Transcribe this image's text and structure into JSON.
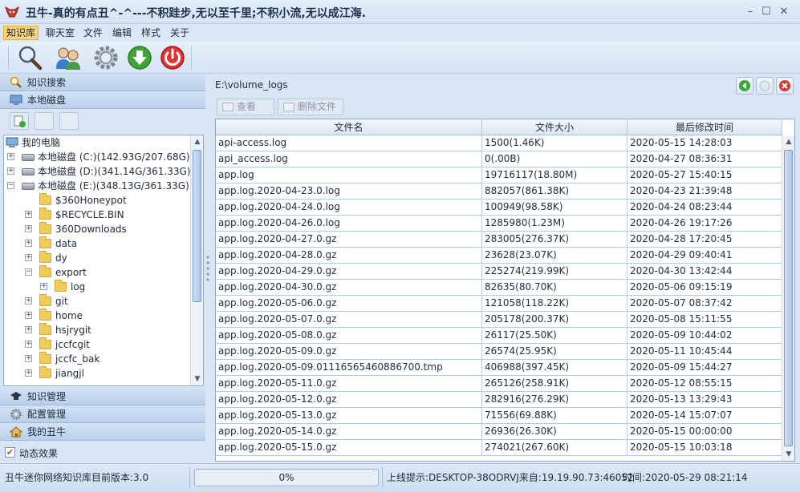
{
  "window": {
    "title": "丑牛-真的有点丑^-^---不积跬步,无以至千里;不积小流,无以成江海.",
    "minimize": "–",
    "maximize": "☐",
    "close": "✕"
  },
  "menu": [
    "知识库",
    "聊天室",
    "文件",
    "编辑",
    "样式",
    "关于"
  ],
  "sidebar": {
    "search": "知识搜索",
    "local_disk": "本地磁盘",
    "knowledge_mgmt": "知识管理",
    "config_mgmt": "配置管理",
    "my_chouniu": "我的丑牛",
    "dynamic_effect": "动态效果",
    "dynamic_effect_checked": true
  },
  "tree": {
    "root": "我的电脑",
    "drives": [
      {
        "label": "本地磁盘 (C:)(142.93G/207.68G)",
        "expander": "+"
      },
      {
        "label": "本地磁盘 (D:)(341.14G/361.33G)",
        "expander": "+"
      },
      {
        "label": "本地磁盘 (E:)(348.13G/361.33G)",
        "expander": "−"
      }
    ],
    "folders": [
      {
        "label": "$360Honeypot",
        "expander": ""
      },
      {
        "label": "$RECYCLE.BIN",
        "expander": "+"
      },
      {
        "label": "360Downloads",
        "expander": "+"
      },
      {
        "label": "data",
        "expander": "+"
      },
      {
        "label": "dy",
        "expander": "+"
      },
      {
        "label": "export",
        "expander": "−"
      },
      {
        "label": "log",
        "expander": "+"
      },
      {
        "label": "git",
        "expander": "+"
      },
      {
        "label": "home",
        "expander": "+"
      },
      {
        "label": "hsjrygit",
        "expander": "+"
      },
      {
        "label": "jccfcgit",
        "expander": "+"
      },
      {
        "label": "jccfc_bak",
        "expander": "+"
      },
      {
        "label": "jiangjl",
        "expander": "+"
      }
    ]
  },
  "path": "E:\\volume_logs",
  "actions": {
    "view": "查看",
    "delete": "删除文件"
  },
  "table": {
    "headers": [
      "文件名",
      "文件大小",
      "最后修改时间"
    ],
    "rows": [
      [
        "api-access.log",
        "1500(1.46K)",
        "2020-05-15 14:28:03"
      ],
      [
        "api_access.log",
        "0(.00B)",
        "2020-04-27 08:36:31"
      ],
      [
        "app.log",
        "19716117(18.80M)",
        "2020-05-27 15:40:15"
      ],
      [
        "app.log.2020-04-23.0.log",
        "882057(861.38K)",
        "2020-04-23 21:39:48"
      ],
      [
        "app.log.2020-04-24.0.log",
        "100949(98.58K)",
        "2020-04-24 08:23:44"
      ],
      [
        "app.log.2020-04-26.0.log",
        "1285980(1.23M)",
        "2020-04-26 19:17:26"
      ],
      [
        "app.log.2020-04-27.0.gz",
        "283005(276.37K)",
        "2020-04-28 17:20:45"
      ],
      [
        "app.log.2020-04-28.0.gz",
        "23628(23.07K)",
        "2020-04-29 09:40:41"
      ],
      [
        "app.log.2020-04-29.0.gz",
        "225274(219.99K)",
        "2020-04-30 13:42:44"
      ],
      [
        "app.log.2020-04-30.0.gz",
        "82635(80.70K)",
        "2020-05-06 09:15:19"
      ],
      [
        "app.log.2020-05-06.0.gz",
        "121058(118.22K)",
        "2020-05-07 08:37:42"
      ],
      [
        "app.log.2020-05-07.0.gz",
        "205178(200.37K)",
        "2020-05-08 15:11:55"
      ],
      [
        "app.log.2020-05-08.0.gz",
        "26117(25.50K)",
        "2020-05-09 10:44:02"
      ],
      [
        "app.log.2020-05-09.0.gz",
        "26574(25.95K)",
        "2020-05-11 10:45:44"
      ],
      [
        "app.log.2020-05-09.01116565460886700.tmp",
        "406988(397.45K)",
        "2020-05-09 15:44:27"
      ],
      [
        "app.log.2020-05-11.0.gz",
        "265126(258.91K)",
        "2020-05-12 08:55:15"
      ],
      [
        "app.log.2020-05-12.0.gz",
        "282916(276.29K)",
        "2020-05-13 13:29:43"
      ],
      [
        "app.log.2020-05-13.0.gz",
        "71556(69.88K)",
        "2020-05-14 15:07:07"
      ],
      [
        "app.log.2020-05-14.0.gz",
        "26936(26.30K)",
        "2020-05-15 00:00:00"
      ],
      [
        "app.log.2020-05-15.0.gz",
        "274021(267.60K)",
        "2020-05-15 10:03:18"
      ]
    ]
  },
  "status": {
    "version": "丑牛迷你网络知识库目前版本:3.0",
    "progress_text": "0%",
    "progress": 0,
    "online": "上线提示:DESKTOP-38ODRVJ来自:19.19.90.73:46052",
    "time": "时间:2020-05-29 08:21:14"
  },
  "colors": {
    "background": "#d7e5f5",
    "menu_active": "#f7d47a",
    "folder": "#f3cc57",
    "power_button": "#e0322f",
    "download_button": "#3da637"
  },
  "icons": {
    "toolbar": [
      "search-icon",
      "users-chat-icon",
      "settings-gear-icon",
      "download-icon",
      "power-icon"
    ],
    "window_controls": [
      "go-icon",
      "refresh-icon",
      "close-icon"
    ]
  }
}
